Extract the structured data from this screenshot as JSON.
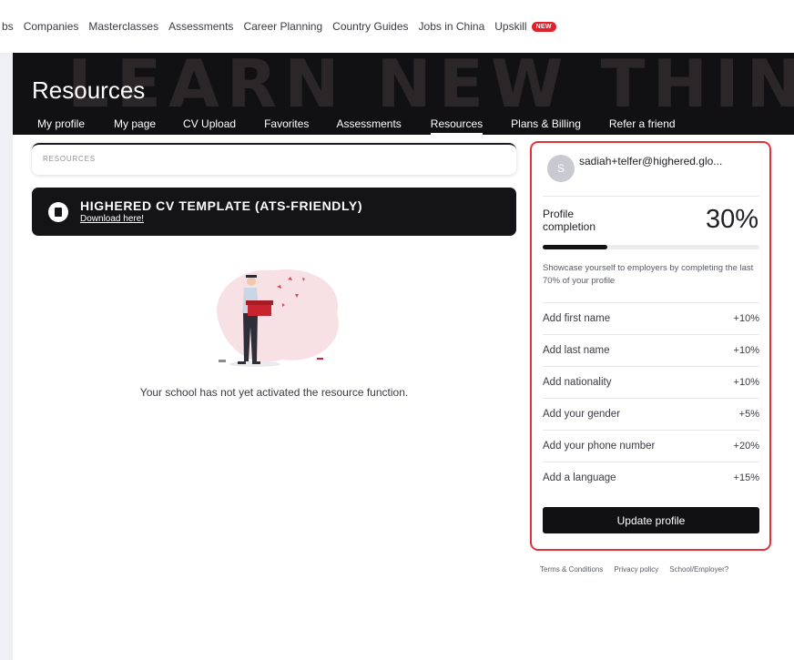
{
  "topnav": {
    "items": [
      "bs",
      "Companies",
      "Masterclasses",
      "Assessments",
      "Career Planning",
      "Country Guides",
      "Jobs in China",
      "Upskill"
    ],
    "new_badge": "NEW"
  },
  "hero": {
    "background_text": "LEARN NEW THINGS",
    "title": "Resources",
    "tabs": [
      "My profile",
      "My page",
      "CV Upload",
      "Favorites",
      "Assessments",
      "Resources",
      "Plans & Billing",
      "Refer a friend"
    ],
    "active_tab": "Resources"
  },
  "main": {
    "breadcrumb": "RESOURCES",
    "cv_banner": {
      "title": "HIGHERED CV TEMPLATE (ATS-FRIENDLY)",
      "link": "Download here!"
    },
    "empty_message": "Your school has not yet activated the resource function."
  },
  "profile": {
    "avatar_letter": "S",
    "email": "sadiah+telfer@highered.glo...",
    "completion_label_line1": "Profile",
    "completion_label_line2": "completion",
    "completion_pct_text": "30%",
    "completion_value": 0.3,
    "showcase_text": "Showcase yourself to employers by completing the last 70% of your profile",
    "tasks": [
      {
        "label": "Add first name",
        "bonus": "+10%"
      },
      {
        "label": "Add last name",
        "bonus": "+10%"
      },
      {
        "label": "Add nationality",
        "bonus": "+10%"
      },
      {
        "label": "Add your gender",
        "bonus": "+5%"
      },
      {
        "label": "Add your phone number",
        "bonus": "+20%"
      },
      {
        "label": "Add a language",
        "bonus": "+15%"
      }
    ],
    "update_button": "Update profile"
  },
  "footer": {
    "links": [
      "Terms & Conditions",
      "Privacy policy",
      "School/Employer?"
    ]
  },
  "colors": {
    "hero_bg": "#111012",
    "highlight_border": "#e23239",
    "badge": "#e0202a"
  }
}
